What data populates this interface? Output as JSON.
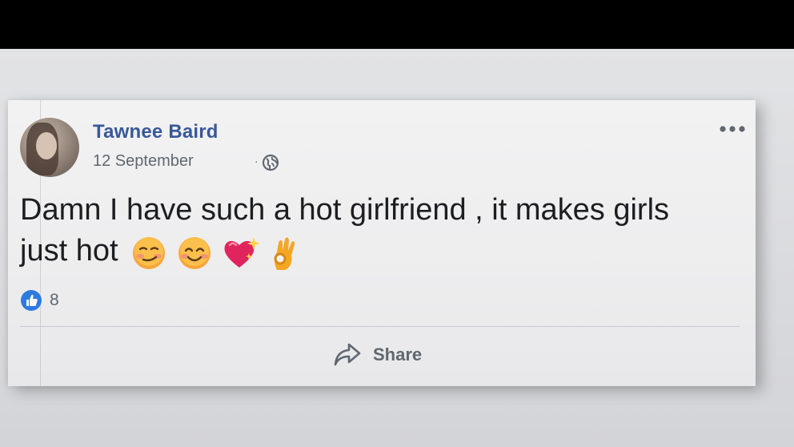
{
  "post": {
    "author": "Tawnee Baird",
    "date": "12 September",
    "separator": "·",
    "privacy_icon": "globe-icon",
    "more_icon": "more-options-icon",
    "text": "Damn I have such a hot girlfriend , it makes girls just hot",
    "emojis": [
      "smirking-face",
      "smiling-face-with-smiling-eyes",
      "sparkling-heart",
      "ok-hand"
    ],
    "likes": {
      "icon": "like-icon",
      "count": "8",
      "color": "#2e7be0"
    },
    "share_label": "Share"
  },
  "colors": {
    "author": "#385898",
    "meta": "#606770",
    "text": "#1c1e21"
  }
}
